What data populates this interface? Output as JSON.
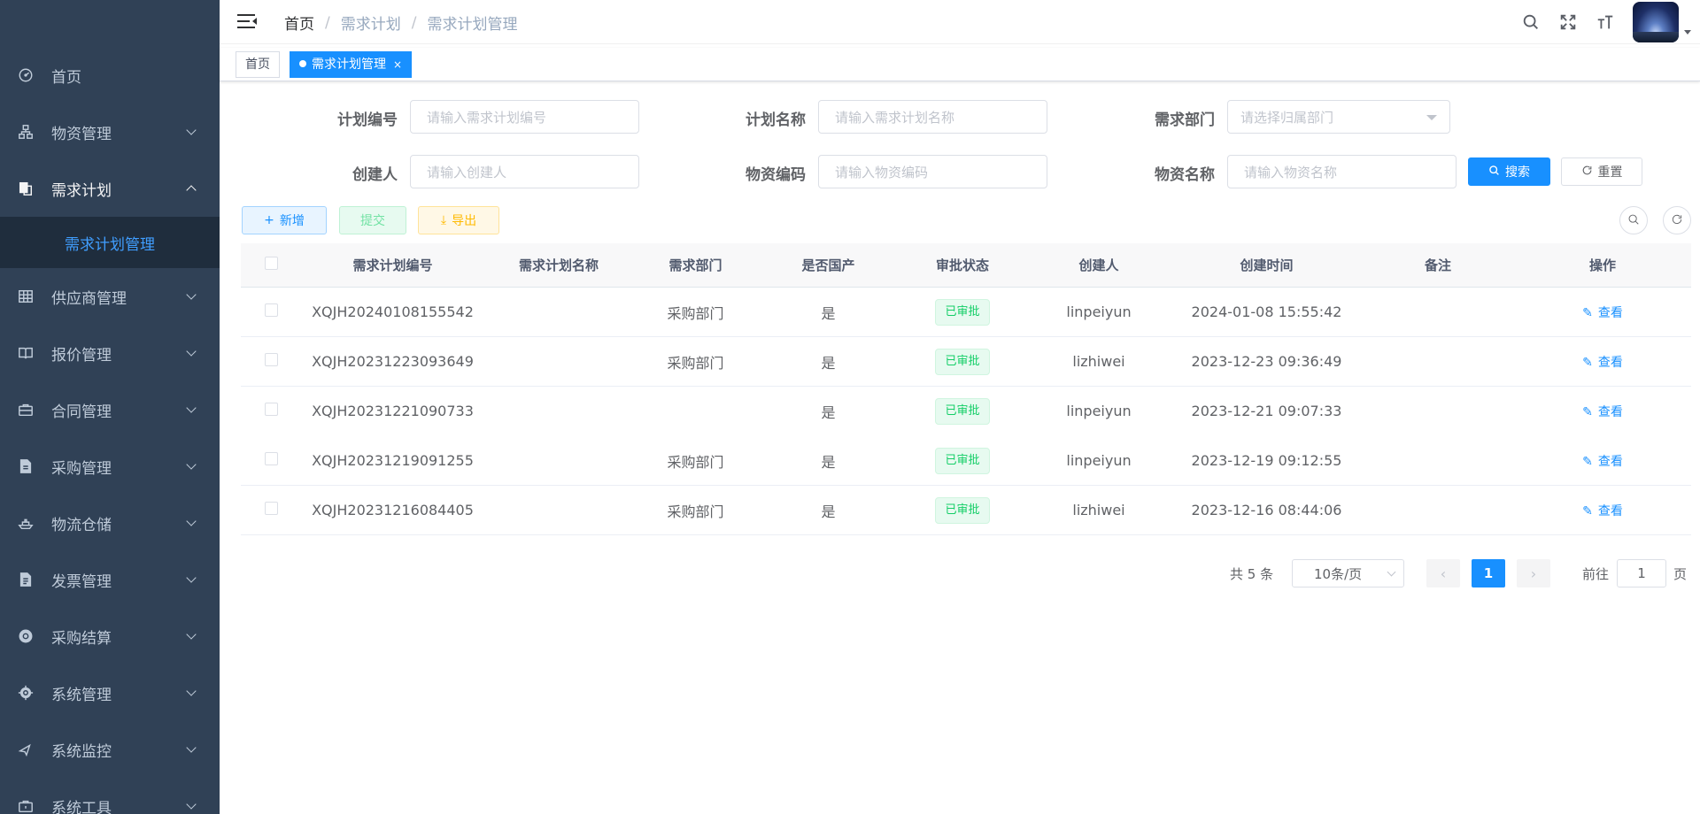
{
  "sidebar": {
    "items": [
      {
        "label": "首页",
        "icon": "dashboard-icon"
      },
      {
        "label": "物资管理",
        "icon": "tree-icon"
      },
      {
        "label": "需求计划",
        "icon": "documents-icon",
        "expanded": true
      },
      {
        "label": "供应商管理",
        "icon": "table-icon"
      },
      {
        "label": "报价管理",
        "icon": "book-icon"
      },
      {
        "label": "合同管理",
        "icon": "briefcase-icon"
      },
      {
        "label": "采购管理",
        "icon": "document-icon"
      },
      {
        "label": "物流仓储",
        "icon": "ship-icon"
      },
      {
        "label": "发票管理",
        "icon": "invoice-icon"
      },
      {
        "label": "采购结算",
        "icon": "settlement-icon"
      },
      {
        "label": "系统管理",
        "icon": "settings-icon"
      },
      {
        "label": "系统监控",
        "icon": "monitor-icon"
      },
      {
        "label": "系统工具",
        "icon": "tool-icon"
      }
    ],
    "active_sub": "需求计划管理"
  },
  "navbar": {
    "breadcrumb": [
      "首页",
      "需求计划",
      "需求计划管理"
    ],
    "separator": "/"
  },
  "tags": {
    "home": "首页",
    "active": "需求计划管理",
    "close": "×"
  },
  "search": {
    "plan_no": {
      "label": "计划编号",
      "placeholder": "请输入需求计划编号"
    },
    "plan_name": {
      "label": "计划名称",
      "placeholder": "请输入需求计划名称"
    },
    "dept": {
      "label": "需求部门",
      "placeholder": "请选择归属部门"
    },
    "creator": {
      "label": "创建人",
      "placeholder": "请输入创建人"
    },
    "material_code": {
      "label": "物资编码",
      "placeholder": "请输入物资编码"
    },
    "material_name": {
      "label": "物资名称",
      "placeholder": "请输入物资名称"
    },
    "search_btn": "搜索",
    "reset_btn": "重置"
  },
  "toolbar": {
    "add": "新增",
    "submit": "提交",
    "export": "导出"
  },
  "table": {
    "columns": [
      "需求计划编号",
      "需求计划名称",
      "需求部门",
      "是否国产",
      "审批状态",
      "创建人",
      "创建时间",
      "备注",
      "操作"
    ],
    "rows": [
      {
        "no": "XQJH20240108155542",
        "name": "",
        "dept": "采购部门",
        "domestic": "是",
        "status": "已审批",
        "creator": "linpeiyun",
        "time": "2024-01-08 15:55:42",
        "remark": "",
        "action": "查看"
      },
      {
        "no": "XQJH20231223093649",
        "name": "",
        "dept": "采购部门",
        "domestic": "是",
        "status": "已审批",
        "creator": "lizhiwei",
        "time": "2023-12-23 09:36:49",
        "remark": "",
        "action": "查看"
      },
      {
        "no": "XQJH20231221090733",
        "name": "",
        "dept": "",
        "domestic": "是",
        "status": "已审批",
        "creator": "linpeiyun",
        "time": "2023-12-21 09:07:33",
        "remark": "",
        "action": "查看"
      },
      {
        "no": "XQJH20231219091255",
        "name": "",
        "dept": "采购部门",
        "domestic": "是",
        "status": "已审批",
        "creator": "linpeiyun",
        "time": "2023-12-19 09:12:55",
        "remark": "",
        "action": "查看"
      },
      {
        "no": "XQJH20231216084405",
        "name": "",
        "dept": "采购部门",
        "domestic": "是",
        "status": "已审批",
        "creator": "lizhiwei",
        "time": "2023-12-16 08:44:06",
        "remark": "",
        "action": "查看"
      }
    ]
  },
  "pagination": {
    "total": "共 5 条",
    "page_size": "10条/页",
    "current": "1",
    "goto_label": "前往",
    "goto_value": "1",
    "page_suffix": "页"
  },
  "colors": {
    "sidebar_bg": "#304156",
    "submenu_bg": "#1f2d3d",
    "primary": "#1890ff",
    "success": "#13ce66"
  }
}
